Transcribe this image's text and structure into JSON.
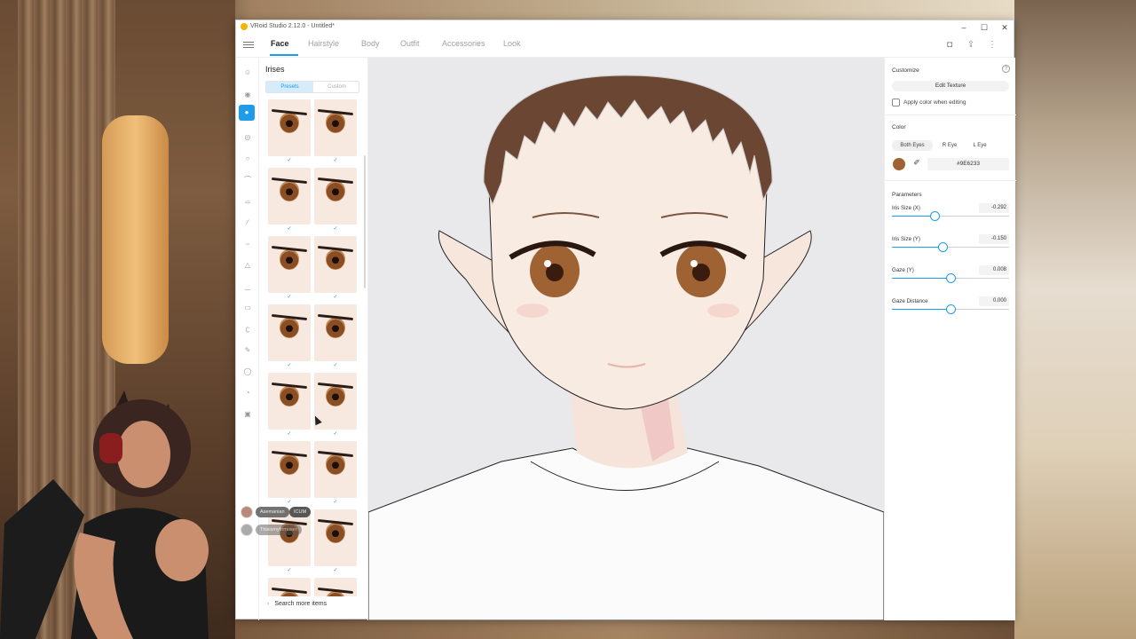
{
  "window": {
    "title": "VRoid Studio 2.12.0 - Untitled*",
    "controls": [
      "–",
      "☐",
      "✕"
    ]
  },
  "nav": {
    "tabs": [
      "Face",
      "Hairstyle",
      "Body",
      "Outfit",
      "Accessories",
      "Look"
    ],
    "active_tab": "Face",
    "icons": [
      "camera-icon",
      "export-icon",
      "more-vertical-icon"
    ]
  },
  "panel": {
    "heading": "Irises",
    "subtabs": [
      "Presets",
      "Custom"
    ],
    "active_subtab": "Presets",
    "search_more": "Search more items",
    "checkmark": "✓"
  },
  "side_panel": {
    "customize_title": "Customize",
    "edit_texture": "Edit Texture",
    "apply_color": "Apply color when editing",
    "color_title": "Color",
    "eye_tabs": [
      "Both Eyes",
      "R Eye",
      "L Eye"
    ],
    "active_eye_tab": "Both Eyes",
    "color_hex": "#9E6233",
    "parameters_title": "Parameters",
    "params": [
      {
        "label": "Iris Size (X)",
        "value": "-0.292",
        "fraction": 0.36
      },
      {
        "label": "Iris Size (Y)",
        "value": "-0.150",
        "fraction": 0.43
      },
      {
        "label": "Gaze (Y)",
        "value": "0.008",
        "fraction": 0.5
      },
      {
        "label": "Gaze Distance",
        "value": "0.000",
        "fraction": 0.5
      }
    ]
  },
  "overlay_chat": {
    "user1": "Asemanian",
    "badge1": "ICUM",
    "user2": "Thisismyfirmuser"
  },
  "colors": {
    "accent": "#1e9bea",
    "iris": "#9E6233",
    "skin": "#f7e9df",
    "hair": "#6b4632"
  }
}
